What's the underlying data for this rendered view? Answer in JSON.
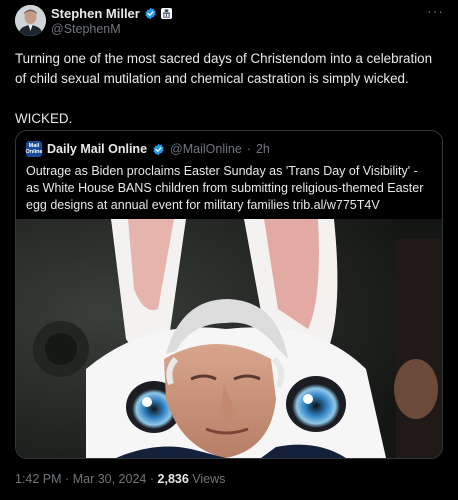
{
  "author": {
    "name": "Stephen Miller",
    "handle": "@StephenM"
  },
  "tweet": {
    "paragraphs": [
      "Turning one of the most sacred days of Christendom into a celebration of child sexual mutilation and chemical castration is simply wicked.",
      "WICKED."
    ]
  },
  "quoted": {
    "logo_text_1": "Mail",
    "logo_text_2": "Online",
    "name": "Daily Mail Online",
    "handle": "@MailOnline",
    "separator": "·",
    "time": "2h",
    "text": "Outrage as Biden proclaims Easter Sunday as 'Trans Day of Visibility' - as White House BANS children from submitting religious-themed Easter egg designs at annual event for military families trib.al/w775T4V"
  },
  "footer": {
    "time": "1:42 PM",
    "separator": "·",
    "date": "Mar 30, 2024",
    "views_count": "2,836",
    "views_label": "Views"
  },
  "more_glyph": "···",
  "colors": {
    "background": "#000000",
    "text": "#e7e9ea",
    "muted": "#71767b",
    "verified": "#1d9bf0",
    "border": "#333639"
  },
  "icons": {
    "verified": "verified-badge-icon",
    "affiliation": "affiliation-badge-icon",
    "more": "more-icon"
  }
}
